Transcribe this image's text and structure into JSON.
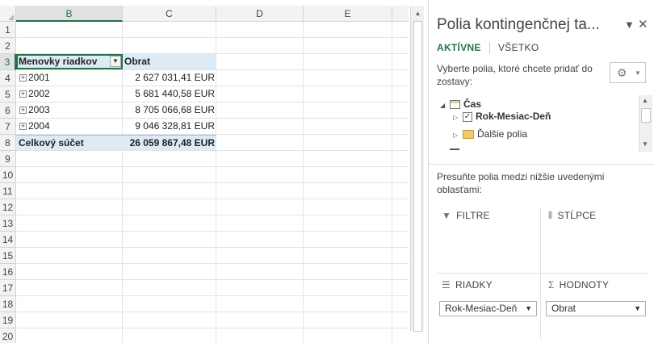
{
  "sheet": {
    "columns": [
      "B",
      "C",
      "D",
      "E"
    ],
    "rows": [
      "1",
      "2",
      "3",
      "4",
      "5",
      "6",
      "7",
      "8",
      "9",
      "10",
      "11",
      "12",
      "13",
      "14",
      "15",
      "16",
      "17",
      "18",
      "19",
      "20"
    ],
    "pivot": {
      "row_label_header": "Menovky riadkov",
      "value_header": "Obrat",
      "rows": [
        {
          "label": "2001",
          "value": "2 627 031,41 EUR"
        },
        {
          "label": "2002",
          "value": "5 681 440,58 EUR"
        },
        {
          "label": "2003",
          "value": "8 705 066,68 EUR"
        },
        {
          "label": "2004",
          "value": "9 046 328,81 EUR"
        }
      ],
      "total_label": "Celkový súčet",
      "total_value": "26 059 867,48 EUR"
    }
  },
  "pane": {
    "title": "Polia kontingenčnej ta...",
    "tabs": [
      "AKTÍVNE",
      "VŠETKO"
    ],
    "hint": "Vyberte polia, ktoré chcete pridať do zostavy:",
    "fields": {
      "table": "Čas",
      "field": "Rok-Mesiac-Deň",
      "more": "Ďalšie polia"
    },
    "move_hint": "Presuňte polia medzi nižšie uvedenými oblasťami:",
    "areas": {
      "filters": "FILTRE",
      "columns": "STĹPCE",
      "rows": "RIADKY",
      "values": "HODNOTY"
    },
    "rows_chip": "Rok-Mesiac-Deň",
    "values_chip": "Obrat"
  },
  "colors": {
    "accent": "#217346",
    "header_band": "#ddebf7"
  }
}
